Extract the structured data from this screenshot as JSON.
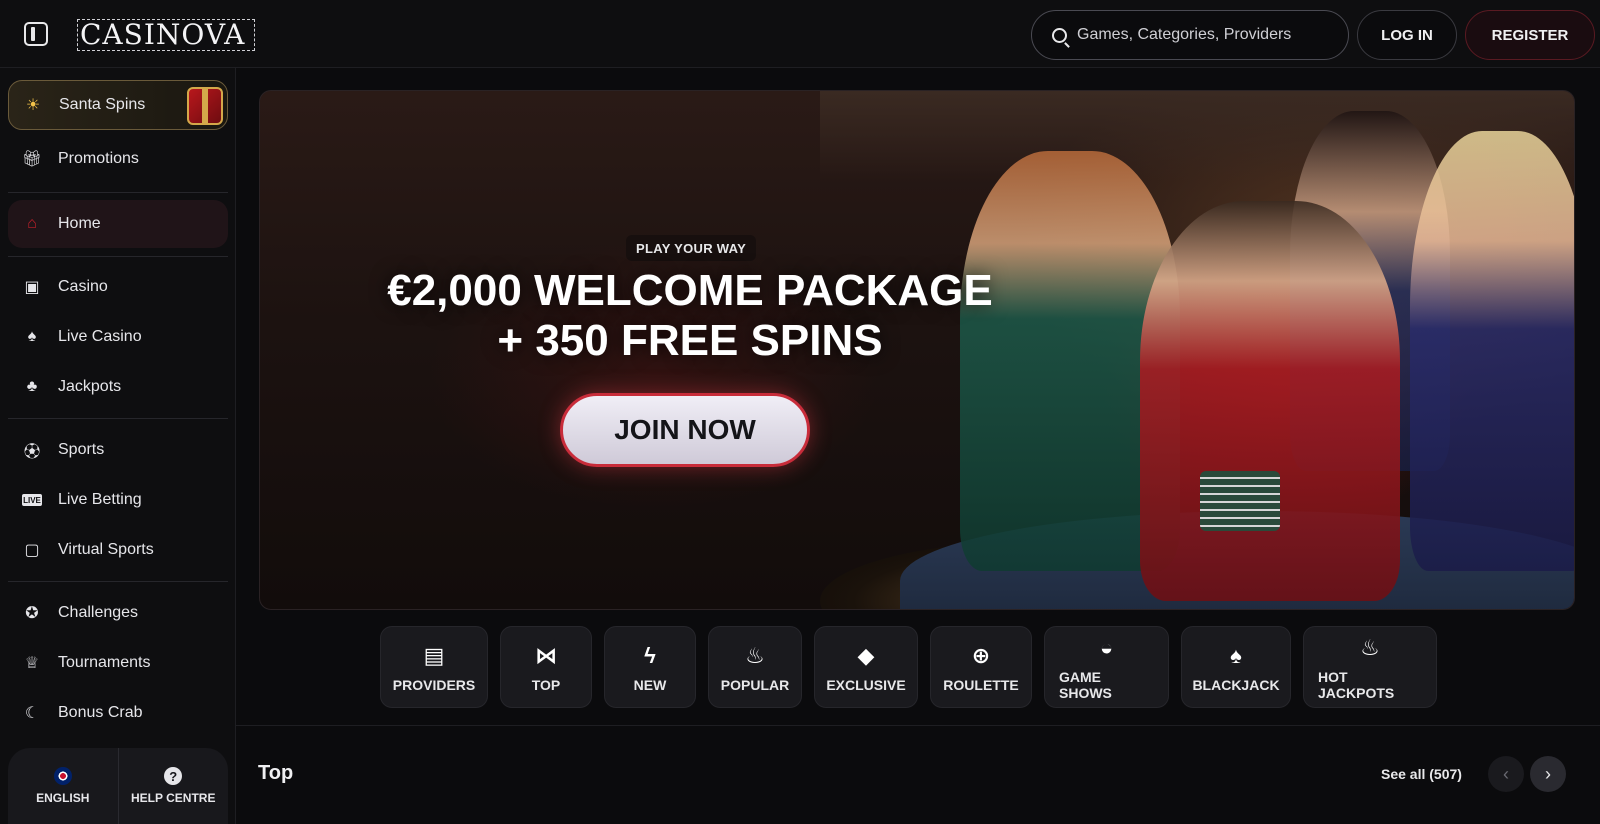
{
  "header": {
    "logo_text": "CASINOVA",
    "search_placeholder": "Games, Categories, Providers",
    "login_label": "LOG IN",
    "register_label": "REGISTER"
  },
  "sidebar": {
    "promo_items": [
      {
        "label": "Santa Spins",
        "icon": "sun-icon"
      },
      {
        "label": "Promotions",
        "icon": "gift-icon"
      }
    ],
    "home": {
      "label": "Home",
      "icon": "home-icon"
    },
    "casino_items": [
      {
        "label": "Casino",
        "icon": "slot-machine-icon"
      },
      {
        "label": "Live Casino",
        "icon": "cards-icon"
      },
      {
        "label": "Jackpots",
        "icon": "clover-icon"
      }
    ],
    "sports_items": [
      {
        "label": "Sports",
        "icon": "soccer-ball-icon"
      },
      {
        "label": "Live Betting",
        "icon": "live-icon"
      },
      {
        "label": "Virtual Sports",
        "icon": "virtual-icon"
      }
    ],
    "extra_items": [
      {
        "label": "Challenges",
        "icon": "medal-icon"
      },
      {
        "label": "Tournaments",
        "icon": "trophy-icon"
      },
      {
        "label": "Bonus Crab",
        "icon": "crab-icon"
      }
    ],
    "footer": {
      "language_label": "ENGLISH",
      "help_label": "HELP CENTRE"
    }
  },
  "banner": {
    "tag": "PLAY YOUR WAY",
    "title_line1": "€2,000 WELCOME PACKAGE",
    "title_line2": "+ 350 FREE SPINS",
    "cta_label": "JOIN NOW"
  },
  "categories": [
    {
      "label": "PROVIDERS",
      "icon": "book-icon"
    },
    {
      "label": "TOP",
      "icon": "bowtie-icon"
    },
    {
      "label": "NEW",
      "icon": "lightning-icon"
    },
    {
      "label": "POPULAR",
      "icon": "flame-icon"
    },
    {
      "label": "EXCLUSIVE",
      "icon": "diamond-icon"
    },
    {
      "label": "ROULETTE",
      "icon": "roulette-icon"
    },
    {
      "label": "GAME SHOWS",
      "icon": "mask-icon"
    },
    {
      "label": "BLACKJACK",
      "icon": "playing-cards-icon"
    },
    {
      "label": "HOT JACKPOTS",
      "icon": "hot-pepper-icon"
    }
  ],
  "section": {
    "title": "Top",
    "see_all": "See all (507)"
  },
  "colors": {
    "accent_red": "#c0202a",
    "gold": "#d4a84a",
    "background": "#0b0b0d"
  }
}
